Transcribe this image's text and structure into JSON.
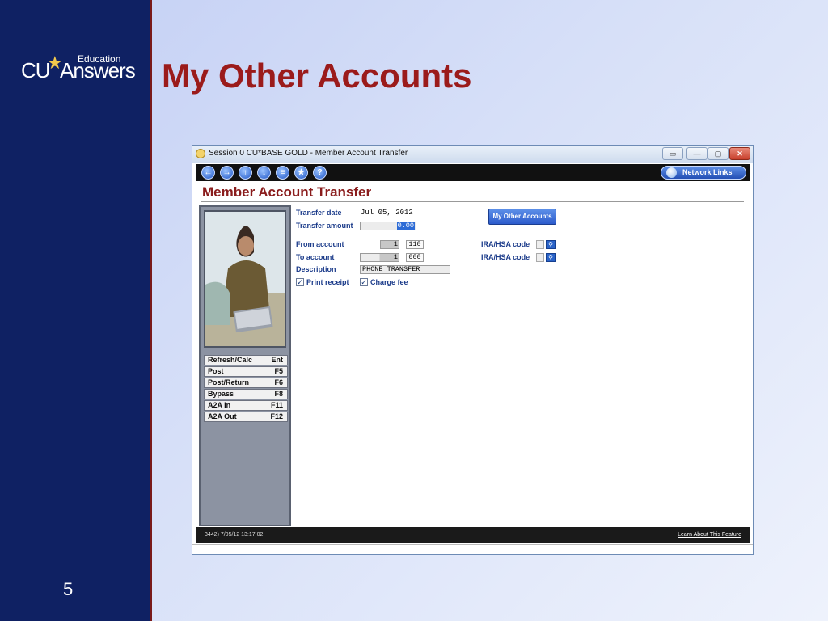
{
  "slide": {
    "logo": {
      "edu": "Education",
      "cu": "CU",
      "answers": "Answers"
    },
    "title": "My Other Accounts",
    "number": "5"
  },
  "window": {
    "title": "Session 0 CU*BASE GOLD - Member Account Transfer",
    "network_links": "Network Links",
    "nav_icons": [
      "back-icon",
      "forward-icon",
      "up-icon",
      "down-icon",
      "home-icon",
      "favorite-icon",
      "help-icon"
    ],
    "screen_title": "Member Account Transfer",
    "status_left": "3442) 7/05/12 13:17:02",
    "status_right": "Learn About This Feature"
  },
  "form": {
    "transfer_date_label": "Transfer date",
    "transfer_date_value": "Jul 05, 2012",
    "transfer_amount_label": "Transfer amount",
    "transfer_amount_value": "0.00",
    "from_account_label": "From account",
    "from_account_acct": "1",
    "from_account_suffix": "110",
    "to_account_label": "To account",
    "to_account_acct": "1",
    "to_account_suffix": "000",
    "description_label": "Description",
    "description_value": "PHONE TRANSFER",
    "print_receipt_label": "Print receipt",
    "print_receipt_checked": true,
    "charge_fee_label": "Charge fee",
    "charge_fee_checked": true,
    "ira_hsa_label_1": "IRA/HSA code",
    "ira_hsa_label_2": "IRA/HSA code",
    "my_other_accounts_button": "My Other Accounts"
  },
  "function_keys": [
    {
      "label": "Refresh/Calc",
      "key": "Ent"
    },
    {
      "label": "Post",
      "key": "F5"
    },
    {
      "label": "Post/Return",
      "key": "F6"
    },
    {
      "label": "Bypass",
      "key": "F8"
    },
    {
      "label": "A2A In",
      "key": "F11"
    },
    {
      "label": "A2A Out",
      "key": "F12"
    }
  ]
}
